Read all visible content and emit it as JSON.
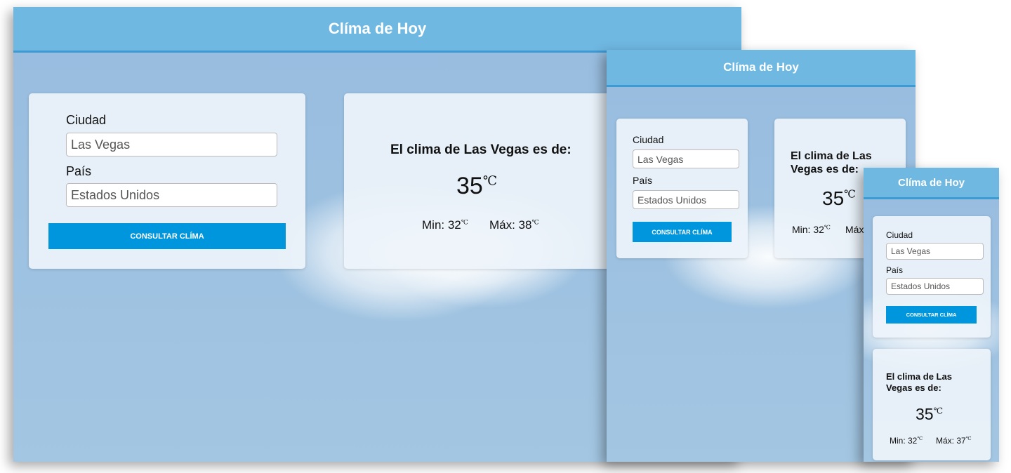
{
  "app": {
    "title": "Clíma de Hoy"
  },
  "form": {
    "city_label": "Ciudad",
    "city_value": "Las Vegas",
    "country_label": "País",
    "country_value": "Estados Unidos",
    "submit_label": "CONSULTAR CLÍMA"
  },
  "result": {
    "heading": "El clima de Las Vegas es de:",
    "temp": "35",
    "unit": "℃",
    "min_label": "Min: 32",
    "max_label": "Máx: 38",
    "max_label_mobile": "Máx: 37"
  },
  "colors": {
    "header": "#6fb8e2",
    "button": "#0096dd",
    "background": "#9bbfdf"
  }
}
